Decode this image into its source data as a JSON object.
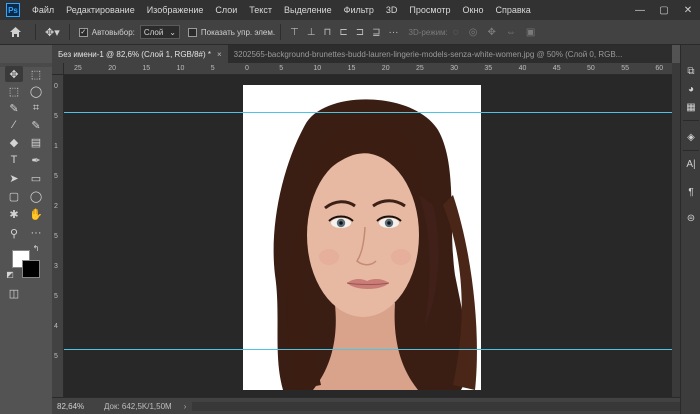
{
  "menubar": {
    "app_logo": "Ps",
    "items": [
      "Файл",
      "Редактирование",
      "Изображение",
      "Слои",
      "Текст",
      "Выделение",
      "Фильтр",
      "3D",
      "Просмотр",
      "Окно",
      "Справка"
    ],
    "minimize": "—",
    "restore": "▢",
    "close": "✕"
  },
  "options": {
    "home_icon": "home-icon",
    "move_icon": "move-icon",
    "autoselect_label": "Автовыбор:",
    "autoselect_checked": true,
    "autoselect_value": "Слой",
    "show_transform_label": "Показать упр. элем.",
    "mode_3d_label": "3D-режим:"
  },
  "tabs": [
    {
      "label": "Без имени-1 @ 82,6% (Слой 1, RGB/8#) *",
      "active": true
    },
    {
      "label": "3202565-background-brunettes-budd-lauren-lingerie-models-senza-white-women.jpg @ 50% (Слой 0, RGB...",
      "active": false
    }
  ],
  "ruler": {
    "h_ticks": [
      "25",
      "20",
      "15",
      "10",
      "5",
      "0",
      "5",
      "10",
      "15",
      "20",
      "25",
      "30",
      "35",
      "40",
      "45",
      "50",
      "55",
      "60"
    ],
    "v_ticks": [
      "0",
      "5",
      "1",
      "5",
      "2",
      "5",
      "3",
      "5",
      "4",
      "5"
    ]
  },
  "status": {
    "zoom": "82,64%",
    "doc_size": "Док: 642,5K/1,50M",
    "arrow": "›"
  },
  "colors": {
    "guide": "#4fc3e4",
    "foreground": "#ffffff",
    "background": "#000000",
    "accent": "#31a8ff"
  }
}
